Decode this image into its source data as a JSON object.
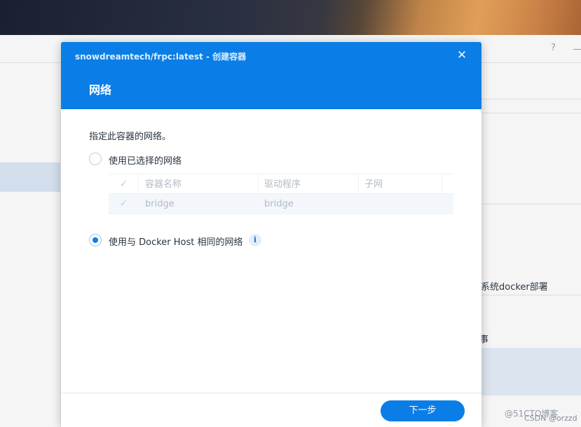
{
  "background": {
    "help_glyph": "?",
    "right_panel": {
      "item_text": "系统docker部署",
      "partial_text": "事"
    },
    "watermark_1": "@51CTO博客",
    "watermark_2": "CSDN @orzzd"
  },
  "dialog": {
    "title": "snowdreamtech/frpc:latest - 创建容器",
    "close_glyph": "✕",
    "step_title": "网络",
    "description": "指定此容器的网络。",
    "option_selected_network": {
      "label": "使用已选择的网络",
      "checked": false
    },
    "network_table": {
      "columns": [
        "容器名称",
        "驱动程序",
        "子网"
      ],
      "rows": [
        {
          "checked": true,
          "name": "bridge",
          "driver": "bridge",
          "subnet": ""
        }
      ]
    },
    "option_host_network": {
      "label": "使用与 Docker Host 相同的网络",
      "checked": true
    },
    "info_glyph": "i",
    "next_button": "下一步"
  },
  "colors": {
    "accent": "#0a7ee6",
    "header_bg": "#0a7ee6",
    "disabled_text": "#b3bbc4"
  },
  "icons": {
    "close": "close-icon",
    "info": "info-icon",
    "check": "check-icon",
    "help": "help-icon"
  }
}
